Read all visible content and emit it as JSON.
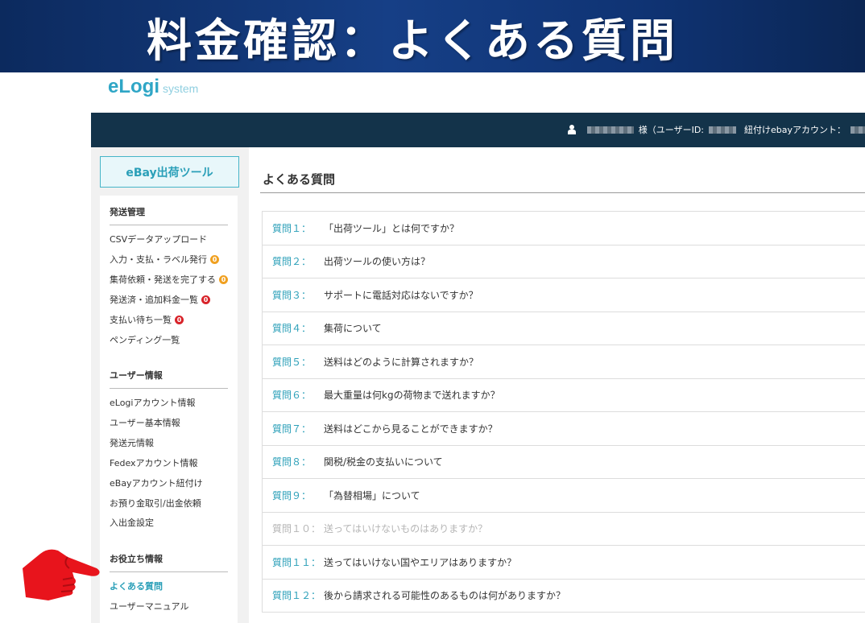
{
  "banner": {
    "title": "料金確認：よくある質問"
  },
  "logo": {
    "main": "eLogi",
    "sub": "system"
  },
  "topbar": {
    "user_suffix": "様（ユーザーID:",
    "linked_label": "紐付けebayアカウント："
  },
  "sidebar": {
    "tool_button": "eBay出荷ツール",
    "sections": [
      {
        "title": "発送管理",
        "items": [
          {
            "label": "CSVデータアップロード"
          },
          {
            "label": "入力・支払・ラベル発行",
            "badge": "0",
            "badge_color": "#f0a020"
          },
          {
            "label": "集荷依頼・発送を完了する",
            "badge": "0",
            "badge_color": "#f0a020"
          },
          {
            "label": "発送済・追加料金一覧",
            "badge": "0",
            "badge_color": "#d8232a"
          },
          {
            "label": "支払い待ち一覧",
            "badge": "0",
            "badge_color": "#d8232a"
          },
          {
            "label": "ペンディング一覧"
          }
        ]
      },
      {
        "title": "ユーザー情報",
        "items": [
          {
            "label": "eLogiアカウント情報"
          },
          {
            "label": "ユーザー基本情報"
          },
          {
            "label": "発送元情報"
          },
          {
            "label": "Fedexアカウント情報"
          },
          {
            "label": "eBayアカウント紐付け"
          },
          {
            "label": "お預り金取引/出金依頼"
          },
          {
            "label": "入出金設定"
          }
        ]
      },
      {
        "title": "お役立ち情報",
        "items": [
          {
            "label": "よくある質問",
            "active": true
          },
          {
            "label": "ユーザーマニュアル"
          }
        ]
      }
    ]
  },
  "main": {
    "title": "よくある質問",
    "faqs": [
      {
        "num": "質問１：",
        "q": "「出荷ツール」とは何ですか？"
      },
      {
        "num": "質問２：",
        "q": "出荷ツールの使い方は？"
      },
      {
        "num": "質問３：",
        "q": "サポートに電話対応はないですか？"
      },
      {
        "num": "質問４：",
        "q": "集荷について"
      },
      {
        "num": "質問５：",
        "q": "送料はどのように計算されますか？"
      },
      {
        "num": "質問６：",
        "q": "最大重量は何kgの荷物まで送れますか？"
      },
      {
        "num": "質問７：",
        "q": "送料はどこから見ることができますか？"
      },
      {
        "num": "質問８：",
        "q": "関税/税金の支払いについて"
      },
      {
        "num": "質問９：",
        "q": "「為替相場」について"
      },
      {
        "num": "質問１０：",
        "q": "送ってはいけないものはありますか？",
        "dim": true
      },
      {
        "num": "質問１１：",
        "q": "送ってはいけない国やエリアはありますか？"
      },
      {
        "num": "質問１２：",
        "q": "後から請求される可能性のあるものは何がありますか？"
      }
    ]
  },
  "colors": {
    "accent": "#2a9fb8",
    "topbar": "#13334a",
    "banner": "#163f86",
    "pointer": "#e8141c"
  }
}
